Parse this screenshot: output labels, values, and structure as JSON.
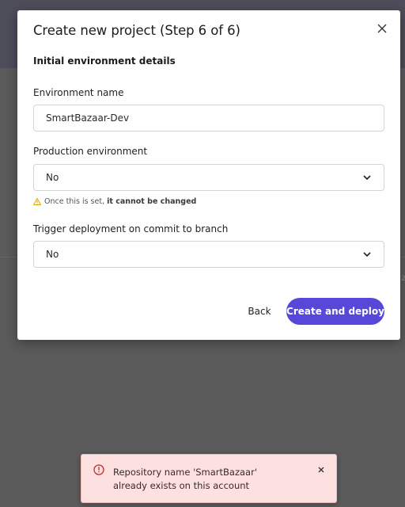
{
  "modal": {
    "title": "Create new project (Step 6 of 6)",
    "section_title": "Initial environment details",
    "fields": {
      "environment_name": {
        "label": "Environment name",
        "value": "SmartBazaar-Dev"
      },
      "production_environment": {
        "label": "Production environment",
        "selected": "No"
      },
      "trigger_deployment": {
        "label": "Trigger deployment on commit to branch",
        "selected": "No"
      }
    },
    "warning": {
      "prefix": "Once this is set, ",
      "emphasis": "it cannot be changed"
    },
    "buttons": {
      "back": "Back",
      "primary": "Create and deploy"
    }
  },
  "toast": {
    "message": "Repository name 'SmartBazaar' already exists on this account"
  },
  "colors": {
    "accent": "#5848d9",
    "warning": "#e0a800",
    "error": "#c62828",
    "toast_bg": "#fde0e0"
  },
  "icons": {
    "close": "close-icon",
    "chevron": "chevron-down-icon",
    "warning": "warning-icon",
    "error": "error-circle-icon"
  }
}
